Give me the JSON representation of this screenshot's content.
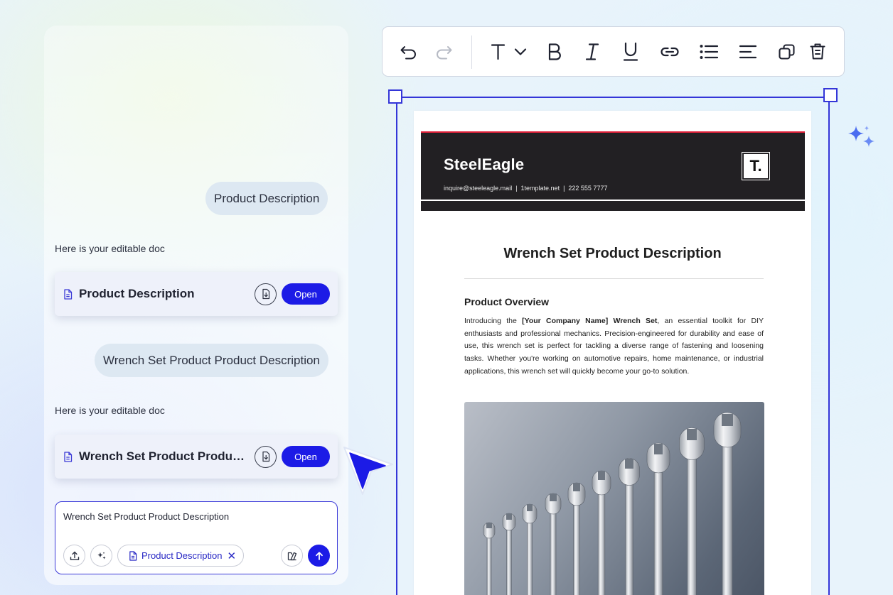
{
  "chat": {
    "messages": [
      {
        "role": "user",
        "text": "Product Description"
      },
      {
        "role": "assistant",
        "text": "Here is your editable doc"
      },
      {
        "role": "user",
        "text": "Wrench Set Product Product Description"
      },
      {
        "role": "assistant",
        "text": "Here is your editable doc"
      }
    ],
    "cards": [
      {
        "title": "Product Description",
        "open_label": "Open"
      },
      {
        "title": "Wrench Set Product Product Description",
        "open_label": "Open"
      }
    ],
    "composer": {
      "value": "Wrench Set Product Product Description",
      "chip_label": "Product Description",
      "chip_close": "✕"
    }
  },
  "toolbar": {
    "tools": [
      "undo-icon",
      "redo-icon",
      "text-style-icon",
      "bold-icon",
      "italic-icon",
      "underline-icon",
      "link-icon",
      "bullet-list-icon",
      "align-left-icon",
      "duplicate-icon",
      "delete-icon"
    ]
  },
  "document": {
    "brand": "SteelEagle",
    "contact": "inquire@steeleagle.mail  |  1template.net  |  222 555 7777",
    "logo": "T.",
    "title": "Wrench Set Product Description",
    "section_title": "Product Overview",
    "para_intro": "Introducing the ",
    "para_bold": "[Your Company Name] Wrench Set",
    "para_rest": ", an essential toolkit for DIY enthusiasts and professional mechanics. Precision-engineered for durability and ease of use, this wrench set is perfect for tackling a diverse range of fastening and loosening tasks. Whether you're working on automotive repairs, home maintenance, or industrial applications, this wrench set will quickly become your go-to solution."
  },
  "colors": {
    "accent": "#1c1be6",
    "selection": "#3436d8",
    "header_bg": "#222023",
    "header_stripe": "#e3213a"
  }
}
